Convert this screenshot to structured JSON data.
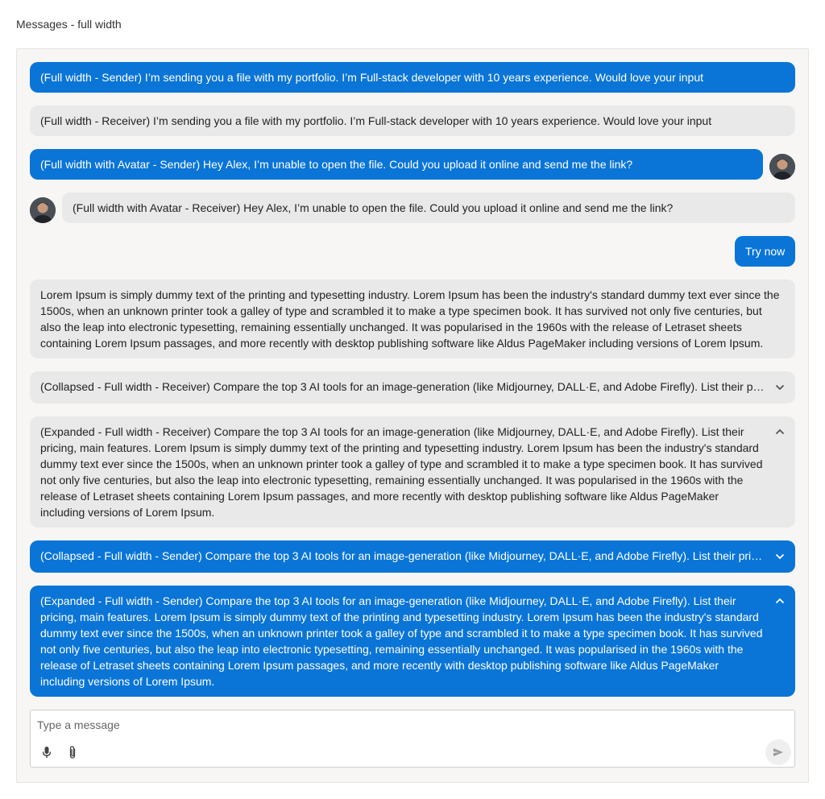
{
  "page": {
    "title": "Messages - full width"
  },
  "messages": {
    "m1": "(Full width - Sender) I’m sending you a file with my portfolio. I’m Full-stack developer with 10 years experience. Would love your input",
    "m2": "(Full width - Receiver) I’m sending you a file with my portfolio. I’m Full-stack developer with 10 years experience. Would love your input",
    "m3": "(Full width with Avatar - Sender) Hey Alex, I’m unable to open the file. Could you upload it online and send me the link?",
    "m4": "(Full width with Avatar - Receiver) Hey Alex, I’m unable to open the file. Could you upload it online and send me the link?",
    "m5": "Try now",
    "m6": "Lorem Ipsum is simply dummy text of the printing and typesetting industry. Lorem Ipsum has been the industry's standard dummy text ever since the 1500s, when an unknown printer took a galley of type and scrambled it to make a type specimen book. It has survived not only five centuries, but also the leap into electronic typesetting, remaining essentially unchanged. It was popularised in the 1960s with the release of Letraset sheets containing Lorem Ipsum passages, and more recently with desktop publishing software like Aldus PageMaker including versions of Lorem Ipsum.",
    "m7": "(Collapsed - Full width - Receiver) Compare the top 3 AI tools for an image-generation (like Midjourney, DALL·E, and Adobe Firefly). List their pricing, main features. Lorem Ipsum is simply dummy text of the printing and typesetting industry.",
    "m8": "(Expanded - Full width - Receiver) Compare the top 3 AI tools for an image-generation (like Midjourney, DALL·E, and Adobe Firefly). List their pricing, main features. Lorem Ipsum is simply dummy text of the printing and typesetting industry. Lorem Ipsum has been the industry's standard dummy text ever since the 1500s, when an unknown printer took a galley of type and scrambled it to make a type specimen book. It has survived not only five centuries, but also the leap into electronic typesetting, remaining essentially unchanged. It was popularised in the 1960s with the release of Letraset sheets containing Lorem Ipsum passages, and more recently with desktop publishing software like Aldus PageMaker including versions of Lorem Ipsum.",
    "m9": "(Collapsed - Full width - Sender) Compare the top 3 AI tools for an image-generation (like Midjourney, DALL·E, and Adobe Firefly). List their pricing, main features. Lorem Ipsum is simply dummy text of the printing and typesetting industry.",
    "m10": "(Expanded - Full width - Sender) Compare the top 3 AI tools for an image-generation (like Midjourney, DALL·E, and Adobe Firefly). List their pricing, main features. Lorem Ipsum is simply dummy text of the printing and typesetting industry. Lorem Ipsum has been the industry's standard dummy text ever since the 1500s, when an unknown printer took a galley of type and scrambled it to make a type specimen book. It has survived not only five centuries, but also the leap into electronic typesetting, remaining essentially unchanged. It was popularised in the 1960s with the release of Letraset sheets containing Lorem Ipsum passages, and more recently with desktop publishing software like Aldus PageMaker including versions of Lorem Ipsum."
  },
  "composer": {
    "placeholder": "Type a message",
    "value": ""
  },
  "icons": {
    "expand": "chevron-down-icon",
    "collapse": "chevron-up-icon",
    "mic": "microphone-icon",
    "attach": "paperclip-icon",
    "send": "send-icon"
  },
  "colors": {
    "sender_bubble": "#0a75d6",
    "receiver_bubble": "#e9e9e9",
    "panel_background": "#f7f6f4"
  }
}
